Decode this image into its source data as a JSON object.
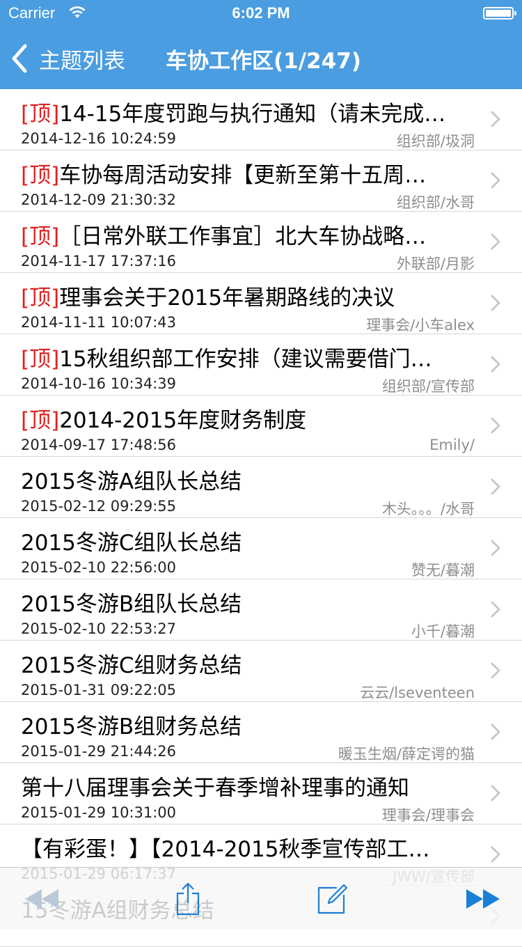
{
  "status_bar": {
    "carrier": "Carrier",
    "time": "6:02 PM"
  },
  "nav": {
    "back_label": "主题列表",
    "title": "车协工作区(1/247)"
  },
  "colors": {
    "nav_bg": "#4a9de0",
    "top_tag": "#e02020",
    "toolbar_icon": "#1a7fd6"
  },
  "topics": [
    {
      "tag": "[顶]",
      "title": "14-15年度罚跑与执行通知（请未完成…",
      "date": "2014-12-16 10:24:59",
      "author": "组织部/圾洞"
    },
    {
      "tag": "[顶]",
      "title": "车协每周活动安排【更新至第十五周…",
      "date": "2014-12-09 21:30:32",
      "author": "组织部/水哥"
    },
    {
      "tag": "[顶]",
      "title": "［日常外联工作事宜］北大车协战略…",
      "date": "2014-11-17 17:37:16",
      "author": "外联部/月影"
    },
    {
      "tag": "[顶]",
      "title": "理事会关于2015年暑期路线的决议",
      "date": "2014-11-11 10:07:43",
      "author": "理事会/小车alex"
    },
    {
      "tag": "[顶]",
      "title": "15秋组织部工作安排（建议需要借门…",
      "date": "2014-10-16 10:34:39",
      "author": "组织部/宣传部"
    },
    {
      "tag": "[顶]",
      "title": "2014-2015年度财务制度",
      "date": "2014-09-17 17:48:56",
      "author": "Emily/"
    },
    {
      "tag": "",
      "title": "2015冬游A组队长总结",
      "date": "2015-02-12 09:29:55",
      "author": "木头。。。/水哥"
    },
    {
      "tag": "",
      "title": "2015冬游C组队长总结",
      "date": "2015-02-10 22:56:00",
      "author": "赞无/暮潮"
    },
    {
      "tag": "",
      "title": "2015冬游B组队长总结",
      "date": "2015-02-10 22:53:27",
      "author": "小千/暮潮"
    },
    {
      "tag": "",
      "title": "2015冬游C组财务总结",
      "date": "2015-01-31 09:22:05",
      "author": "云云/lseventeen"
    },
    {
      "tag": "",
      "title": "2015冬游B组财务总结",
      "date": "2015-01-29 21:44:26",
      "author": "暖玉生烟/薛定谔的猫"
    },
    {
      "tag": "",
      "title": "第十八届理事会关于春季增补理事的通知",
      "date": "2015-01-29 10:31:00",
      "author": "理事会/理事会"
    },
    {
      "tag": "",
      "title": "【有彩蛋！】【2014-2015秋季宣传部工…",
      "date": "2015-01-29 06:17:37",
      "author": "JWW/宣传部"
    },
    {
      "tag": "",
      "title": "15冬游A组财务总结",
      "date": "",
      "author": ""
    }
  ],
  "toolbar": {
    "icons": [
      "rewind-icon",
      "share-icon",
      "compose-icon",
      "fast-forward-icon"
    ]
  }
}
